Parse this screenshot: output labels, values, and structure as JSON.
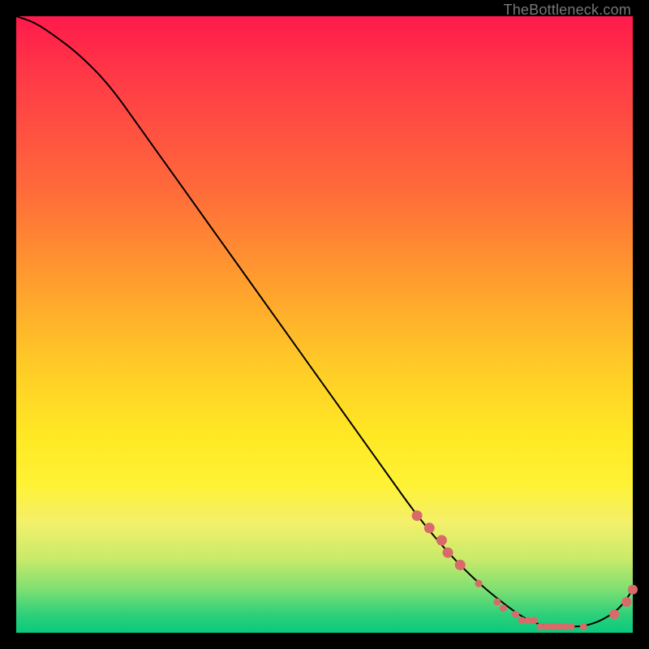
{
  "watermark": "TheBottleneck.com",
  "colors": {
    "dot": "#d86a6a",
    "line": "#000000",
    "frame_bg": "#000000"
  },
  "chart_data": {
    "type": "line",
    "title": "",
    "xlabel": "",
    "ylabel": "",
    "xlim": [
      0,
      100
    ],
    "ylim": [
      0,
      100
    ],
    "grid": false,
    "legend": false,
    "series": [
      {
        "name": "bottleneck-curve",
        "x": [
          0,
          3,
          6,
          10,
          15,
          20,
          25,
          30,
          35,
          40,
          45,
          50,
          55,
          60,
          65,
          70,
          75,
          80,
          83,
          86,
          89,
          92,
          95,
          98,
          100
        ],
        "y": [
          100,
          99,
          97,
          94,
          89,
          82,
          75,
          68,
          61,
          54,
          47,
          40,
          33,
          26,
          19,
          13,
          8,
          4,
          2,
          1,
          1,
          1,
          2,
          4,
          7
        ]
      }
    ],
    "highlight_points": {
      "comment": "salmon dots along the curve near the valley",
      "x": [
        65,
        67,
        69,
        70,
        72,
        75,
        78,
        79,
        81,
        82,
        83,
        84,
        85,
        86,
        87,
        88,
        89,
        90,
        92,
        97,
        99,
        100
      ],
      "y": [
        19,
        17,
        15,
        13,
        11,
        8,
        5,
        4,
        3,
        2,
        2,
        2,
        1,
        1,
        1,
        1,
        1,
        1,
        1,
        3,
        5,
        7
      ]
    }
  }
}
